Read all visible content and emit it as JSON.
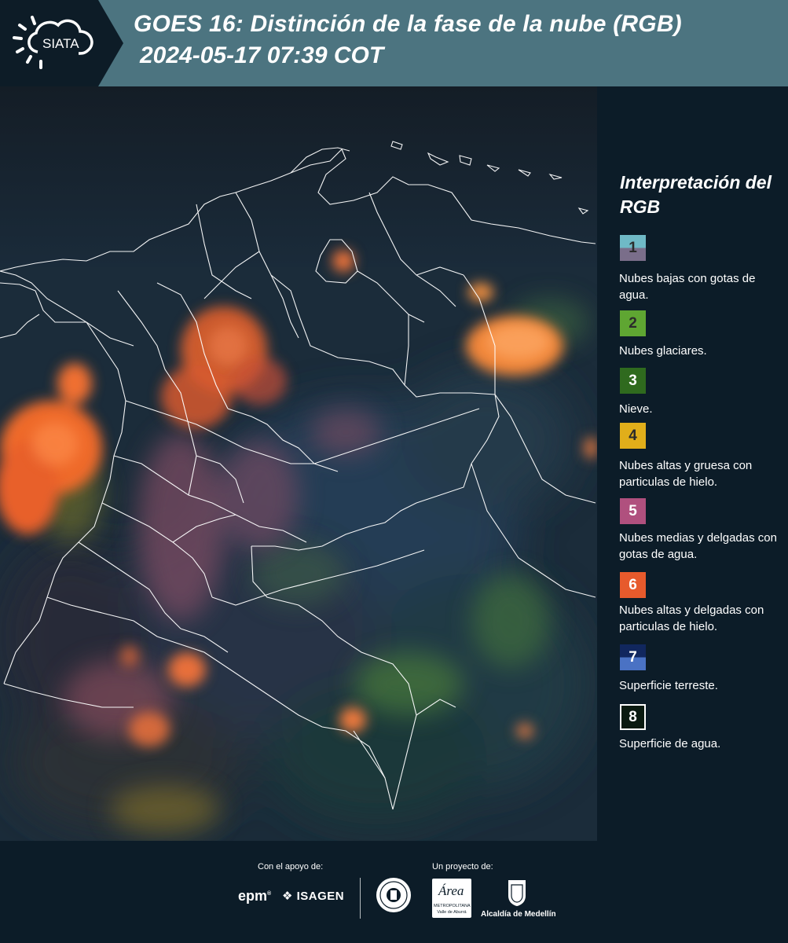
{
  "header": {
    "logo_text": "SIATA",
    "title_line1": "GOES 16: Distinción de la fase de la nube (RGB)",
    "title_line2": "2024-05-17 07:39 COT"
  },
  "legend": {
    "title": "Interpretación del RGB",
    "items": [
      {
        "number": "1",
        "label": "Nubes bajas con gotas de agua.",
        "color_top": "#6fb9c6",
        "color_bottom": "#7a6e8a"
      },
      {
        "number": "2",
        "label": "Nubes glaciares.",
        "color_top": "#5fa632",
        "color_bottom": "#5fa632"
      },
      {
        "number": "3",
        "label": "Nieve.",
        "color_top": "#2f6a1e",
        "color_bottom": "#2f6a1e"
      },
      {
        "number": "4",
        "label": "Nubes altas y gruesa con particulas de hielo.",
        "color_top": "#e1ae1a",
        "color_bottom": "#e1ae1a"
      },
      {
        "number": "5",
        "label": "Nubes medias y delgadas con gotas de agua.",
        "color_top": "#b0507e",
        "color_bottom": "#b0507e"
      },
      {
        "number": "6",
        "label": "Nubes altas y delgadas con particulas de hielo.",
        "color_top": "#e75a2c",
        "color_bottom": "#e75a2c"
      },
      {
        "number": "7",
        "label": "Superficie terreste.",
        "color_top": "#11275e",
        "color_bottom": "#4a72c4"
      },
      {
        "number": "8",
        "label": "Superficie de agua.",
        "color_top": "#0a1a10",
        "color_bottom": "#0a1a10"
      }
    ]
  },
  "footer": {
    "support_label": "Con el apoyo de:",
    "project_label": "Un proyecto de:",
    "sponsor1": "epm",
    "sponsor2": "ISAGEN",
    "partner1": "Área Metropolitana Valle de Aburrá",
    "partner1_mark": "Área",
    "partner1_sub1": "METROPOLITANA",
    "partner1_sub2": "Valle de Aburrá",
    "partner2": "Alcaldía de Medellín"
  }
}
